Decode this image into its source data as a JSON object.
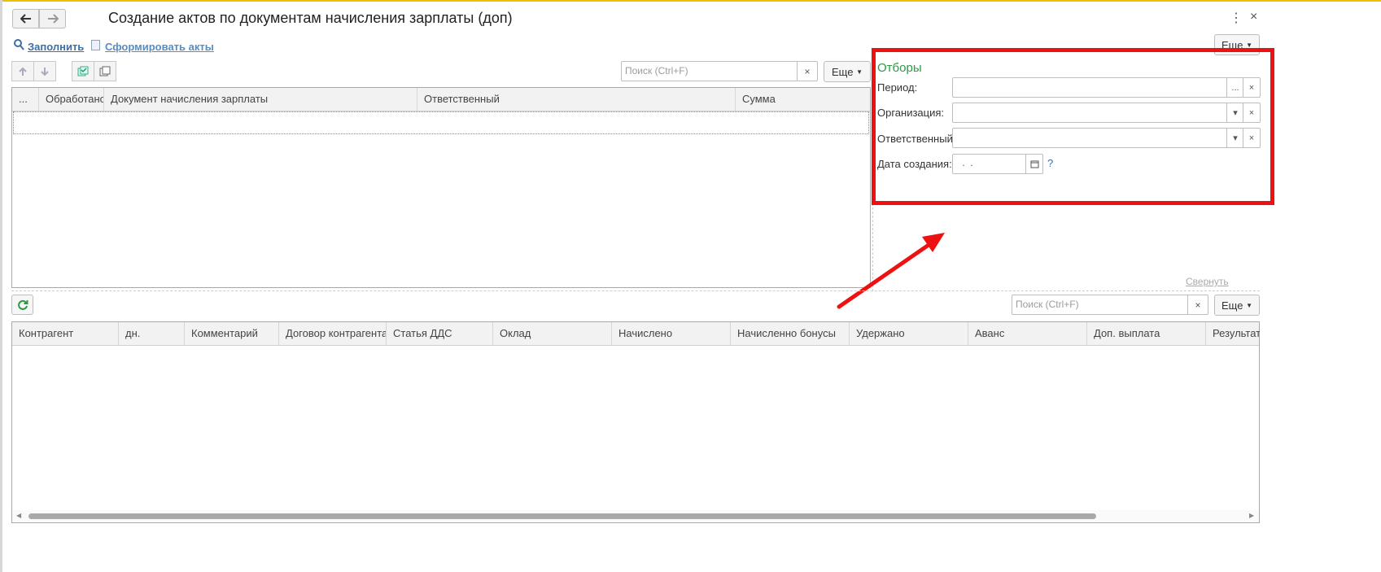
{
  "window": {
    "title": "Создание актов по документам начисления зарплаты (доп)"
  },
  "nav": {
    "back_icon": "arrow-left",
    "forward_icon": "arrow-right"
  },
  "commands": {
    "fill_label": "Заполнить",
    "form_acts_label": "Сформировать акты",
    "more_label": "Еще"
  },
  "top_table": {
    "search_placeholder": "Поиск (Ctrl+F)",
    "more_label": "Еще",
    "columns": [
      "...",
      "Обработано",
      "Документ начисления зарплаты",
      "Ответственный",
      "Сумма"
    ]
  },
  "filters": {
    "title": "Отборы",
    "period_label": "Период:",
    "organization_label": "Организация:",
    "responsible_label": "Ответственный:",
    "creation_date_label": "Дата создания:",
    "creation_date_value": " .  .",
    "help": "?",
    "collapse_label": "Свернуть"
  },
  "bottom_table": {
    "search_placeholder": "Поиск (Ctrl+F)",
    "more_label": "Еще",
    "columns": [
      "Контрагент",
      "дн.",
      "Комментарий",
      "Договор контрагента",
      "Статья ДДС",
      "Оклад",
      "Начислено",
      "Начисленно бонусы",
      "Удержано",
      "Аванс",
      "Доп. выплата",
      "Результат"
    ]
  },
  "colors": {
    "accent_green": "#2a9a45",
    "highlight_red": "#ee1111",
    "link_blue": "#3c6fa8"
  }
}
